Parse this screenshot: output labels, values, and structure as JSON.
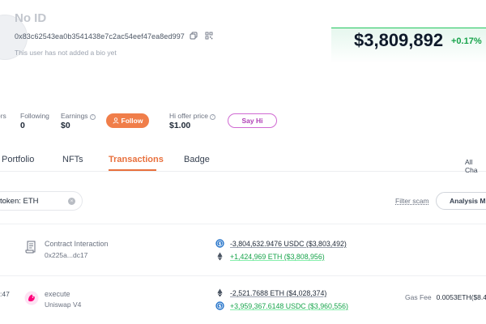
{
  "profile": {
    "name": "No ID",
    "address": "0x83c62543ea0b3541438e7c2ac54eef47ea8ed997",
    "bio": "This user has not added a bio yet",
    "net_worth": "$3,809,892",
    "change_pct": "+0.17%"
  },
  "stats": {
    "followers_label": "ers",
    "following_label": "Following",
    "following_value": "0",
    "earnings_label": "Earnings",
    "earnings_value": "$0",
    "hi_offer_label": "Hi offer price",
    "hi_offer_value": "$1.00",
    "help_glyph": "?"
  },
  "buttons": {
    "follow": "Follow",
    "say_hi": "Say Hi"
  },
  "tabs": [
    "Portfolio",
    "NFTs",
    "Transactions",
    "Badge"
  ],
  "all_chains_label": "All Cha",
  "filter": {
    "token_chip": "token: ETH",
    "chip_close": "×",
    "filter_scam": "Filter scam",
    "analysis_button": "Analysis M"
  },
  "transactions": [
    {
      "time": "",
      "icon": "contract-scroll-icon",
      "title": "Contract Interaction",
      "subtitle": "0x225a...dc17",
      "amounts": [
        {
          "token_icon": "usdc-icon",
          "text": "-3,804,632.9476 USDC ($3,803,492)",
          "direction": "out"
        },
        {
          "token_icon": "eth-icon",
          "text": "+1,424,969 ETH ($3,808,956)",
          "direction": "in"
        }
      ]
    },
    {
      "time": ":47",
      "icon": "uniswap-icon",
      "title": "execute",
      "subtitle": "Uniswap V4",
      "amounts": [
        {
          "token_icon": "eth-icon",
          "text": "-2,521.7688 ETH ($4,028,374)",
          "direction": "out"
        },
        {
          "token_icon": "usdc-icon",
          "text": "+3,959,367.6148 USDC ($3,960,556)",
          "direction": "in"
        }
      ],
      "gas_label": "Gas Fee",
      "gas_value": "0.0053ETH($8.44"
    }
  ],
  "colors": {
    "accent": "#e8703d",
    "positive": "#16a34a",
    "say_hi": "#b041b6",
    "usdc": "#2775ca"
  }
}
